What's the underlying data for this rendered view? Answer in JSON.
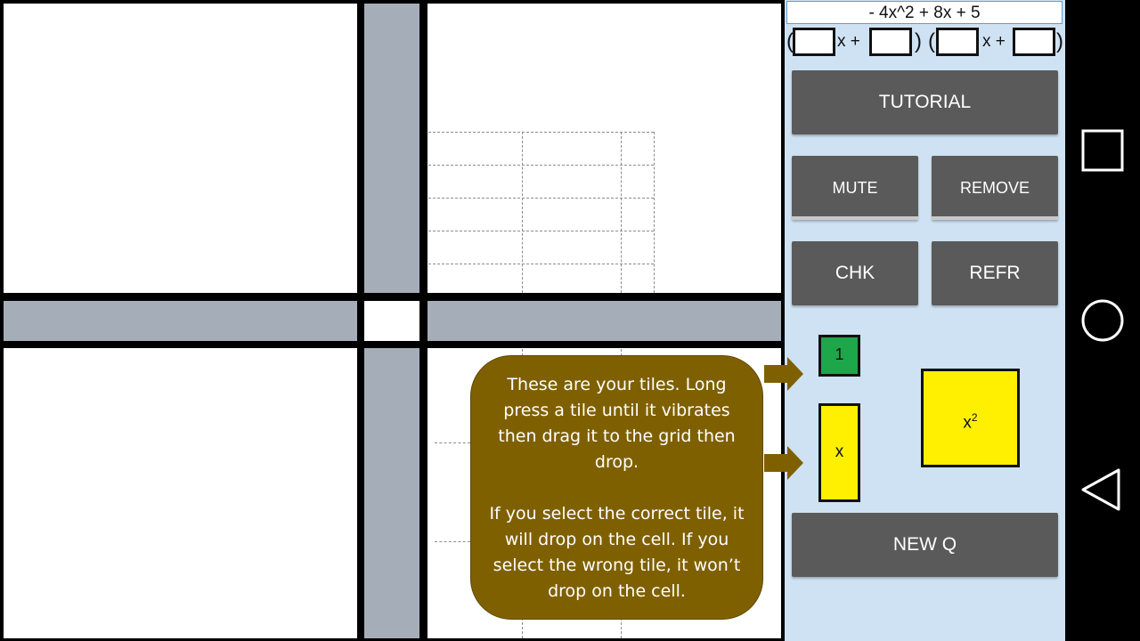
{
  "equation": {
    "text": "- 4x^2 + 8x + 5"
  },
  "factor_form": {
    "open_paren": "(",
    "close_paren": ")",
    "x_plus_1": "x +",
    "x_plus_2": "x +",
    "inputs": [
      "",
      "",
      "",
      ""
    ]
  },
  "buttons": {
    "tutorial": "TUTORIAL",
    "mute": "MUTE",
    "remove": "REMOVE",
    "check": "CHK",
    "refresh": "REFR",
    "new_question": "NEW Q"
  },
  "tiles": {
    "unit": "1",
    "x": "x",
    "x_squared_base": "x",
    "x_squared_exp": "2"
  },
  "tutorial": {
    "paragraph1": "These are your tiles. Long press a tile until it vibrates then drag it to the grid then drop.",
    "paragraph2": "If you select the correct tile, it will drop on the cell. If you select the wrong tile, it won’t drop on the cell."
  },
  "colors": {
    "panel_bg": "#cfe2f3",
    "button_bg": "#5a5a5a",
    "bubble_bg": "#7f6000",
    "tile_green": "#1da64a",
    "tile_yellow": "#ffef00",
    "grid_gray": "#a5adb8"
  },
  "nav": {
    "icons": [
      "square-recents-icon",
      "circle-home-icon",
      "triangle-back-icon"
    ]
  }
}
